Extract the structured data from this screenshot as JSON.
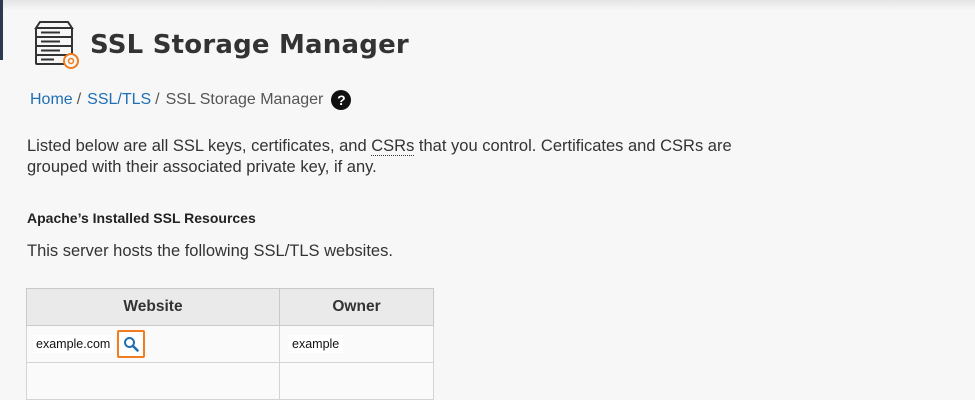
{
  "page": {
    "title": "SSL Storage Manager",
    "icon": "ssl-storage-icon"
  },
  "breadcrumb": {
    "home": "Home",
    "sep1": "/",
    "ssl_tls": "SSL/TLS",
    "sep2": "/",
    "current": "SSL Storage Manager",
    "help_icon": "help-icon"
  },
  "description": {
    "part1": "Listed below are all SSL keys, certificates, and ",
    "csrs": "CSRs",
    "part2": " that you control. Certificates and CSRs are grouped with their associated private key, if any."
  },
  "section": {
    "heading": "Apache’s Installed SSL Resources",
    "hosts_text": "This server hosts the following SSL/TLS websites."
  },
  "table": {
    "headers": [
      "Website",
      "Owner"
    ],
    "rows": [
      {
        "website": "example.com",
        "owner": "example",
        "action_icon": "search-icon"
      }
    ]
  },
  "colors": {
    "link": "#1f6fb5",
    "highlight": "#f07c1e",
    "icon_accent": "#f07c1e"
  }
}
